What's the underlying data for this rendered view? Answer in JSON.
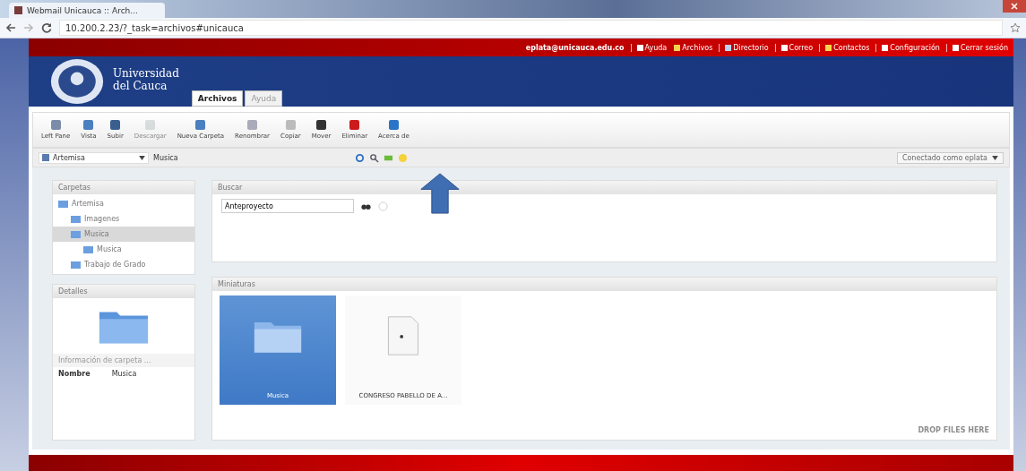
{
  "browser": {
    "tab_title": "Webmail Unicauca :: Arch...",
    "url": "10.200.2.23/?_task=archivos#unicauca"
  },
  "top_bar": {
    "user": "eplata@unicauca.edu.co",
    "links": [
      {
        "label": "Ayuda",
        "kind": "help"
      },
      {
        "label": "Archivos",
        "kind": "files"
      },
      {
        "label": "Directorio",
        "kind": "directory"
      },
      {
        "label": "Correo",
        "kind": "mail"
      },
      {
        "label": "Contactos",
        "kind": "contacts"
      },
      {
        "label": "Configuración",
        "kind": "settings"
      },
      {
        "label": "Cerrar sesión",
        "kind": "logout"
      }
    ]
  },
  "logo_text": [
    "Universidad",
    "del Cauca"
  ],
  "tabs": [
    {
      "label": "Archivos",
      "selected": true
    },
    {
      "label": "Ayuda",
      "selected": false
    }
  ],
  "toolbar": [
    {
      "label": "Left Pane",
      "kind": "pane",
      "disabled": false
    },
    {
      "label": "Vista",
      "kind": "view",
      "disabled": false
    },
    {
      "label": "Subir",
      "kind": "up",
      "disabled": false
    },
    {
      "label": "Descargar",
      "kind": "down",
      "disabled": true
    },
    {
      "label": "Nueva Carpeta",
      "kind": "newfolder",
      "disabled": false
    },
    {
      "label": "Renombrar",
      "kind": "rename",
      "disabled": false
    },
    {
      "label": "Copiar",
      "kind": "copy",
      "disabled": false
    },
    {
      "label": "Mover",
      "kind": "move",
      "disabled": false
    },
    {
      "label": "Eliminar",
      "kind": "delete",
      "disabled": false
    },
    {
      "label": "Acerca de",
      "kind": "about",
      "disabled": false
    }
  ],
  "path_bar": {
    "drive": "Artemisa",
    "path": "Musica",
    "connection": "Conectado como eplata"
  },
  "folders_panel": {
    "title": "Carpetas",
    "tree": [
      {
        "label": "Artemisa",
        "selected": false,
        "children": [
          {
            "label": "Imagenes",
            "selected": false
          },
          {
            "label": "Musica",
            "selected": true,
            "children": [
              {
                "label": "Musica",
                "selected": false
              }
            ]
          },
          {
            "label": "Trabajo de Grado",
            "selected": false
          }
        ]
      }
    ]
  },
  "details_panel": {
    "title": "Detalles",
    "info_title": "Información de carpeta ...",
    "fields": [
      {
        "label": "Nombre",
        "value": "Musica"
      }
    ]
  },
  "search_panel": {
    "title": "Buscar",
    "value": "Anteproyecto"
  },
  "thumbnails_panel": {
    "title": "Miniaturas",
    "items": [
      {
        "name": "Musica",
        "kind": "folder",
        "selected": true
      },
      {
        "name": "CONGRESO PABELLO DE A...",
        "kind": "file",
        "selected": false
      }
    ],
    "drop_hint": "DROP FILES HERE"
  }
}
